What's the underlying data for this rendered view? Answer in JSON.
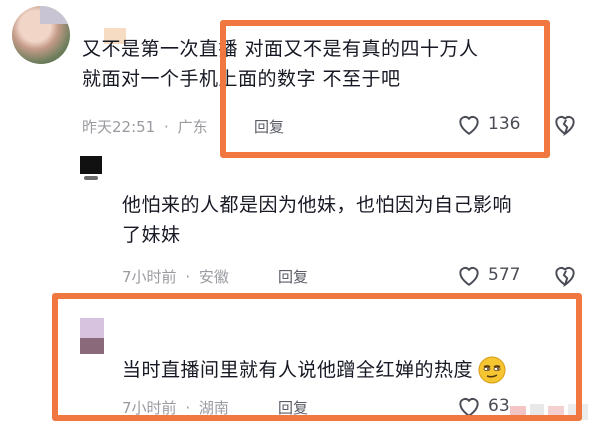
{
  "comments": [
    {
      "lines": [
        "又不是第一次直播  对面又不是有真的四十万人",
        "就面对一个手机上面的数字  不至于吧"
      ],
      "time": "昨天22:51",
      "location": "广东",
      "reply_label": "回复",
      "likes": "136"
    },
    {
      "lines": [
        "他怕来的人都是因为他妹，也怕因为自己影响",
        "了妹妹"
      ],
      "time": "7小时前",
      "location": "安徽",
      "reply_label": "回复",
      "likes": "577"
    },
    {
      "lines": [
        "当时直播间里就有人说他蹭全红婵的热度"
      ],
      "time": "7小时前",
      "location": "湖南",
      "reply_label": "回复",
      "likes": "63"
    }
  ],
  "separator": "·",
  "icons": {
    "like": "heart-outline-icon",
    "dislike": "broken-heart-icon",
    "emoji": "smirk-emoji-icon"
  },
  "colors": {
    "annotation": "#f07840",
    "meta_text": "#9a9ba0"
  }
}
